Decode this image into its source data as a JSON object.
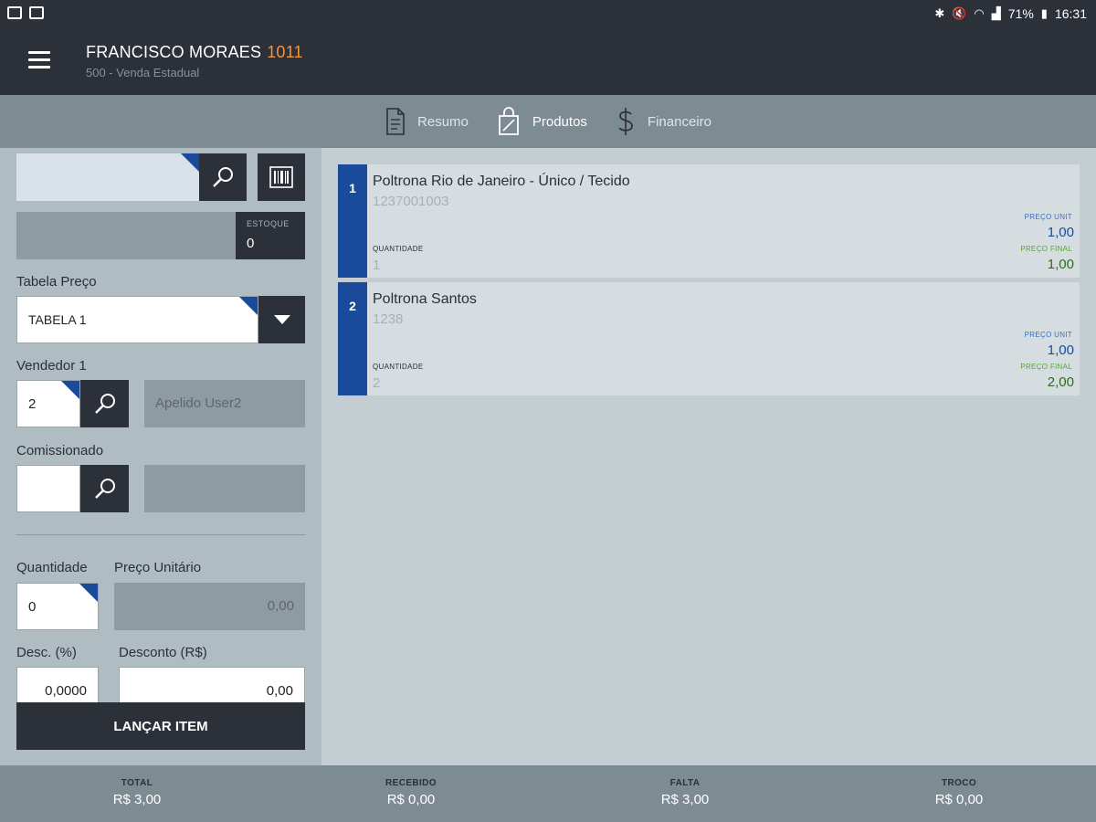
{
  "status_bar": {
    "battery": "71%",
    "time": "16:31",
    "icons": [
      "bluetooth-icon",
      "mute-icon",
      "wifi-icon",
      "signal-icon",
      "battery-icon"
    ]
  },
  "header": {
    "client_name": "FRANCISCO MORAES",
    "client_code": "1011",
    "subtitle": "500 - Venda Estadual",
    "menu_icon": "hamburger-menu-icon"
  },
  "tabs": [
    {
      "label": "Resumo",
      "icon": "document-icon"
    },
    {
      "label": "Produtos",
      "icon": "shopping-bag-icon",
      "active": true
    },
    {
      "label": "Financeiro",
      "icon": "dollar-icon"
    }
  ],
  "left_panel": {
    "search": {
      "value": "",
      "icon": "search-icon"
    },
    "barcode_icon": "barcode-icon",
    "stock": {
      "label": "ESTOQUE",
      "value": "0"
    },
    "price_table": {
      "label": "Tabela Preço",
      "selected": "TABELA 1"
    },
    "seller": {
      "label": "Vendedor 1",
      "value": "2",
      "name": "Apelido User2"
    },
    "commissioned": {
      "label": "Comissionado",
      "value": "",
      "name": ""
    },
    "quantity": {
      "label": "Quantidade",
      "value": "0"
    },
    "unit_price": {
      "label": "Preço Unitário",
      "value": "0,00"
    },
    "discount_pct": {
      "label": "Desc. (%)",
      "value": "0,0000"
    },
    "discount_value": {
      "label": "Desconto (R$)",
      "value": "0,00"
    },
    "launch_button": "LANÇAR ITEM"
  },
  "items": [
    {
      "index": "1",
      "name": "Poltrona Rio de Janeiro - Único / Tecido",
      "code": "1237001003",
      "qty_label": "QUANTIDADE",
      "qty": "1",
      "unit_label": "PREÇO UNIT",
      "unit": "1,00",
      "final_label": "PREÇO FINAL",
      "final": "1,00"
    },
    {
      "index": "2",
      "name": "Poltrona Santos",
      "code": "1238",
      "qty_label": "QUANTIDADE",
      "qty": "2",
      "unit_label": "PREÇO UNIT",
      "unit": "1,00",
      "final_label": "PREÇO FINAL",
      "final": "2,00"
    }
  ],
  "footer": {
    "total": {
      "label": "TOTAL",
      "value": "R$ 3,00"
    },
    "received": {
      "label": "RECEBIDO",
      "value": "R$ 0,00"
    },
    "missing": {
      "label": "FALTA",
      "value": "R$ 3,00"
    },
    "change": {
      "label": "TROCO",
      "value": "R$ 0,00"
    }
  },
  "colors": {
    "dark": "#2c3039",
    "accent_blue": "#1a4a9a",
    "accent_orange": "#f0953c",
    "final_price_green": "#2e6b1f"
  }
}
